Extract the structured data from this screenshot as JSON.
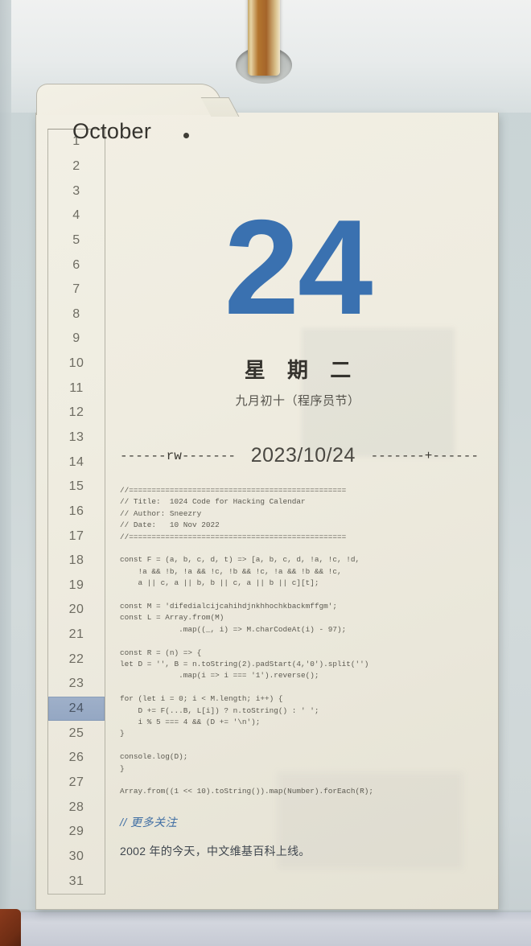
{
  "photo": {
    "object": "desk tear-off calendar page held by a brass clip stand",
    "clip": "brass-clip"
  },
  "calendar": {
    "month": "October",
    "day_number": "24",
    "weekday": "星 期 二",
    "lunar": "九月初十（程序员节）",
    "selected_day": 24,
    "days": [
      1,
      2,
      3,
      4,
      5,
      6,
      7,
      8,
      9,
      10,
      11,
      12,
      13,
      14,
      15,
      16,
      17,
      18,
      19,
      20,
      21,
      22,
      23,
      24,
      25,
      26,
      27,
      28,
      29,
      30,
      31
    ],
    "divider": {
      "left": "------rw-------",
      "date": "2023/10/24",
      "right": "-------+------"
    },
    "colors": {
      "day_number": "#3a71b0",
      "paper": "#efece0",
      "highlight": "#97a9c5",
      "link": "#3f6ea3"
    }
  },
  "code": {
    "lines": [
      "//================================================",
      "// Title:  1024 Code for Hacking Calendar",
      "// Author: Sneezry",
      "// Date:   10 Nov 2022",
      "//================================================",
      "",
      "const F = (a, b, c, d, t) => [a, b, c, d, !a, !c, !d,",
      "    !a && !b, !a && !c, !b && !c, !a && !b && !c,",
      "    a || c, a || b, b || c, a || b || c][t];",
      "",
      "const M = 'difedialcijcahihdjnkhhochkbackmffgm';",
      "const L = Array.from(M)",
      "             .map((_, i) => M.charCodeAt(i) - 97);",
      "",
      "const R = (n) => {",
      "let D = '', B = n.toString(2).padStart(4,'0').split('')",
      "             .map(i => i === '1').reverse();",
      "",
      "for (let i = 0; i < M.length; i++) {",
      "    D += F(...B, L[i]) ? n.toString() : ' ';",
      "    i % 5 === 4 && (D += '\\n');",
      "}",
      "",
      "console.log(D);",
      "}",
      "",
      "Array.from((1 << 10).toString()).map(Number).forEach(R);"
    ]
  },
  "footer": {
    "heading": "// 更多关注",
    "note": "2002 年的今天，中文维基百科上线。"
  }
}
